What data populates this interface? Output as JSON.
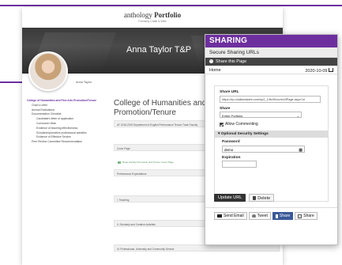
{
  "portfolio": {
    "logo_brand": "anthology",
    "logo_product": "Portfolio",
    "logo_sub": "Formerly Chalk & Wire",
    "owner_name": "Anna Taylor T&P",
    "owner_short": "Anna Taylor",
    "nav": [
      {
        "label": "College of Humanities and Fine Arts Promotion/Tenure",
        "level": 0,
        "active": true
      },
      {
        "label": "Chair's Letter",
        "level": 1
      },
      {
        "label": "Annual Evaluations",
        "level": 1
      },
      {
        "label": "Documentation Checklist",
        "level": 1
      },
      {
        "label": "Candidate's letter of application",
        "level": 2
      },
      {
        "label": "Curriculum Vitae",
        "level": 2
      },
      {
        "label": "Evidence of teaching effectiveness",
        "level": 2
      },
      {
        "label": "Scholarship/creative professional activities",
        "level": 2
      },
      {
        "label": "Evidence of Effective Service",
        "level": 2
      },
      {
        "label": "Peer Review Committee Recommendation",
        "level": 1
      }
    ],
    "heading": "College of Humanities and Fine Arts Promotion/Tenure",
    "sections": [
      "AY 2018-2019 Department of English Performance Tenure Track Faculty",
      "Cover Page",
      "Performance Expectations",
      "I. Teaching",
      "II. Scholarly and Creative Activities",
      "III. Professional, University and Community Service"
    ],
    "cover_link": "Dean Faculty Promotion and Tenure Cover Page"
  },
  "sharing": {
    "title": "SHARING",
    "subtitle": "Secure Sharing URLs",
    "this_page": "Share this Page",
    "row_label": "Home",
    "row_date": "2020-10-09",
    "share_url_label": "Share URL",
    "share_url": "https://ep.chalkandwire.com/ep2_1/fin/SecureUrlPage.aspx?ur",
    "share_label": "Share",
    "share_value": "Entire Portfolio",
    "allow_commenting": "Allow Commenting",
    "optional_settings": "Optional Security Settings",
    "password_label": "Password",
    "password_value": "demo",
    "expiration_label": "Expiration",
    "update_button": "Update URL",
    "delete_button": "Delete",
    "send_email": "Send Email",
    "tweet": "Tweet",
    "share_fb": "Share",
    "share_generic": "Share"
  },
  "colors": {
    "accent": "#6e2f9e"
  }
}
